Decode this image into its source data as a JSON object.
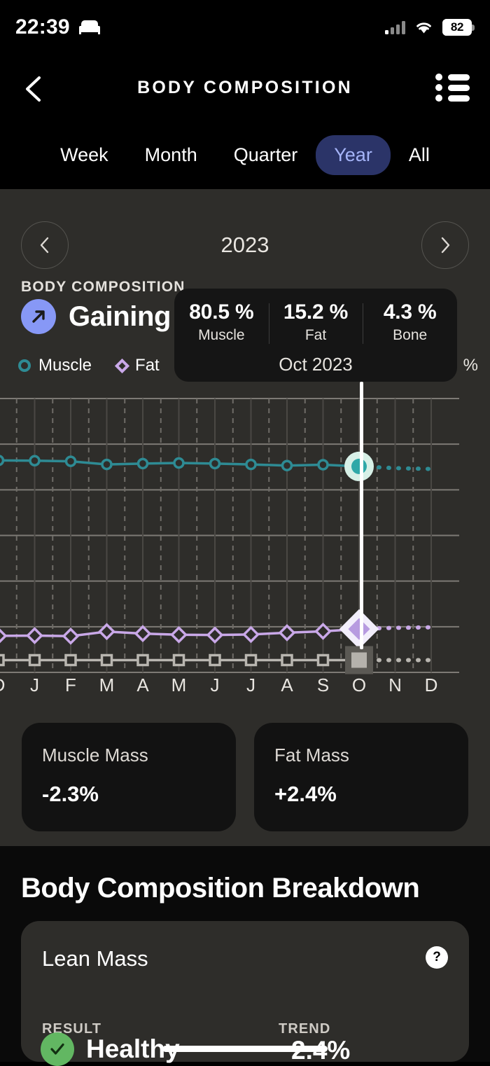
{
  "status_bar": {
    "time": "22:39",
    "bed_icon": "bed-icon",
    "signal_icon": "cellular-signal-icon",
    "wifi_icon": "wifi-icon",
    "battery_level": "82"
  },
  "header": {
    "back_icon": "chevron-left-icon",
    "title": "BODY COMPOSITION",
    "list_icon": "list-view-icon"
  },
  "periods": {
    "items": [
      {
        "label": "Week",
        "active": false
      },
      {
        "label": "Month",
        "active": false
      },
      {
        "label": "Quarter",
        "active": false
      },
      {
        "label": "Year",
        "active": true
      },
      {
        "label": "All",
        "active": false
      }
    ],
    "active_color": "#2b3468",
    "active_text_color": "#a5b4f8"
  },
  "year_nav": {
    "prev_icon": "chevron-left-icon",
    "next_icon": "chevron-right-icon",
    "year": "2023"
  },
  "summary": {
    "kicker": "BODY COMPOSITION",
    "badge_icon": "arrow-up-right-icon",
    "badge_color": "#8798f6",
    "title": "Gaining fat"
  },
  "legend": {
    "items": [
      {
        "label": "Muscle",
        "marker": "circle-marker",
        "color": "#2e8b94"
      },
      {
        "label": "Fat",
        "marker": "diamond-marker",
        "color": "#c9a8e8"
      },
      {
        "label": "Bone",
        "marker": "square-marker",
        "color": "#b9b6b0"
      }
    ],
    "unit": "%"
  },
  "tooltip": {
    "stats": [
      {
        "value": "80.5 %",
        "label": "Muscle"
      },
      {
        "value": "15.2 %",
        "label": "Fat"
      },
      {
        "value": "4.3 %",
        "label": "Bone"
      }
    ],
    "date": "Oct 2023"
  },
  "cards": [
    {
      "label": "Muscle Mass",
      "value": "-2.3%"
    },
    {
      "label": "Fat Mass",
      "value": "+2.4%"
    }
  ],
  "breakdown": {
    "title": "Body Composition Breakdown",
    "card_title": "Lean Mass",
    "help_icon": "question-mark-icon",
    "col_result": "RESULT",
    "col_trend": "TREND",
    "result_icon": "check-circle-icon",
    "result_color": "#62b762",
    "result": "Healthy",
    "trend": "2.4%"
  },
  "chart_data": {
    "type": "line",
    "title": "Body Composition",
    "xlabel": "",
    "ylabel": "%",
    "ylim": [
      0,
      96
    ],
    "yticks": [
      0,
      16,
      32,
      48,
      64,
      80,
      96
    ],
    "grid": true,
    "legend_position": "top-left",
    "highlight": {
      "x": "O",
      "label": "Oct 2023"
    },
    "categories": [
      "D",
      "J",
      "F",
      "M",
      "A",
      "M",
      "J",
      "J",
      "A",
      "S",
      "O",
      "N",
      "D"
    ],
    "series": [
      {
        "name": "Muscle",
        "color": "#2e8b94",
        "marker": "circle",
        "values": [
          74.3,
          74.2,
          74.0,
          72.9,
          73.2,
          73.4,
          73.2,
          72.9,
          72.5,
          72.8,
          80.5,
          null,
          null
        ],
        "projection": [
          null,
          null,
          null,
          null,
          null,
          null,
          null,
          null,
          null,
          null,
          72.2,
          71.6,
          71.3
        ]
      },
      {
        "name": "Fat",
        "color": "#c9a8e8",
        "marker": "diamond",
        "values": [
          12.8,
          12.9,
          12.7,
          14.3,
          13.6,
          13.2,
          13.1,
          13.3,
          13.9,
          14.4,
          15.2,
          null,
          null
        ],
        "projection": [
          null,
          null,
          null,
          null,
          null,
          null,
          null,
          null,
          null,
          null,
          15.3,
          15.6,
          15.8
        ]
      },
      {
        "name": "Bone",
        "color": "#b9b6b0",
        "marker": "square",
        "values": [
          4.3,
          4.3,
          4.3,
          4.3,
          4.3,
          4.3,
          4.3,
          4.3,
          4.3,
          4.3,
          4.3,
          null,
          null
        ],
        "projection": [
          null,
          null,
          null,
          null,
          null,
          null,
          null,
          null,
          null,
          null,
          4.3,
          4.3,
          4.3
        ]
      }
    ]
  }
}
